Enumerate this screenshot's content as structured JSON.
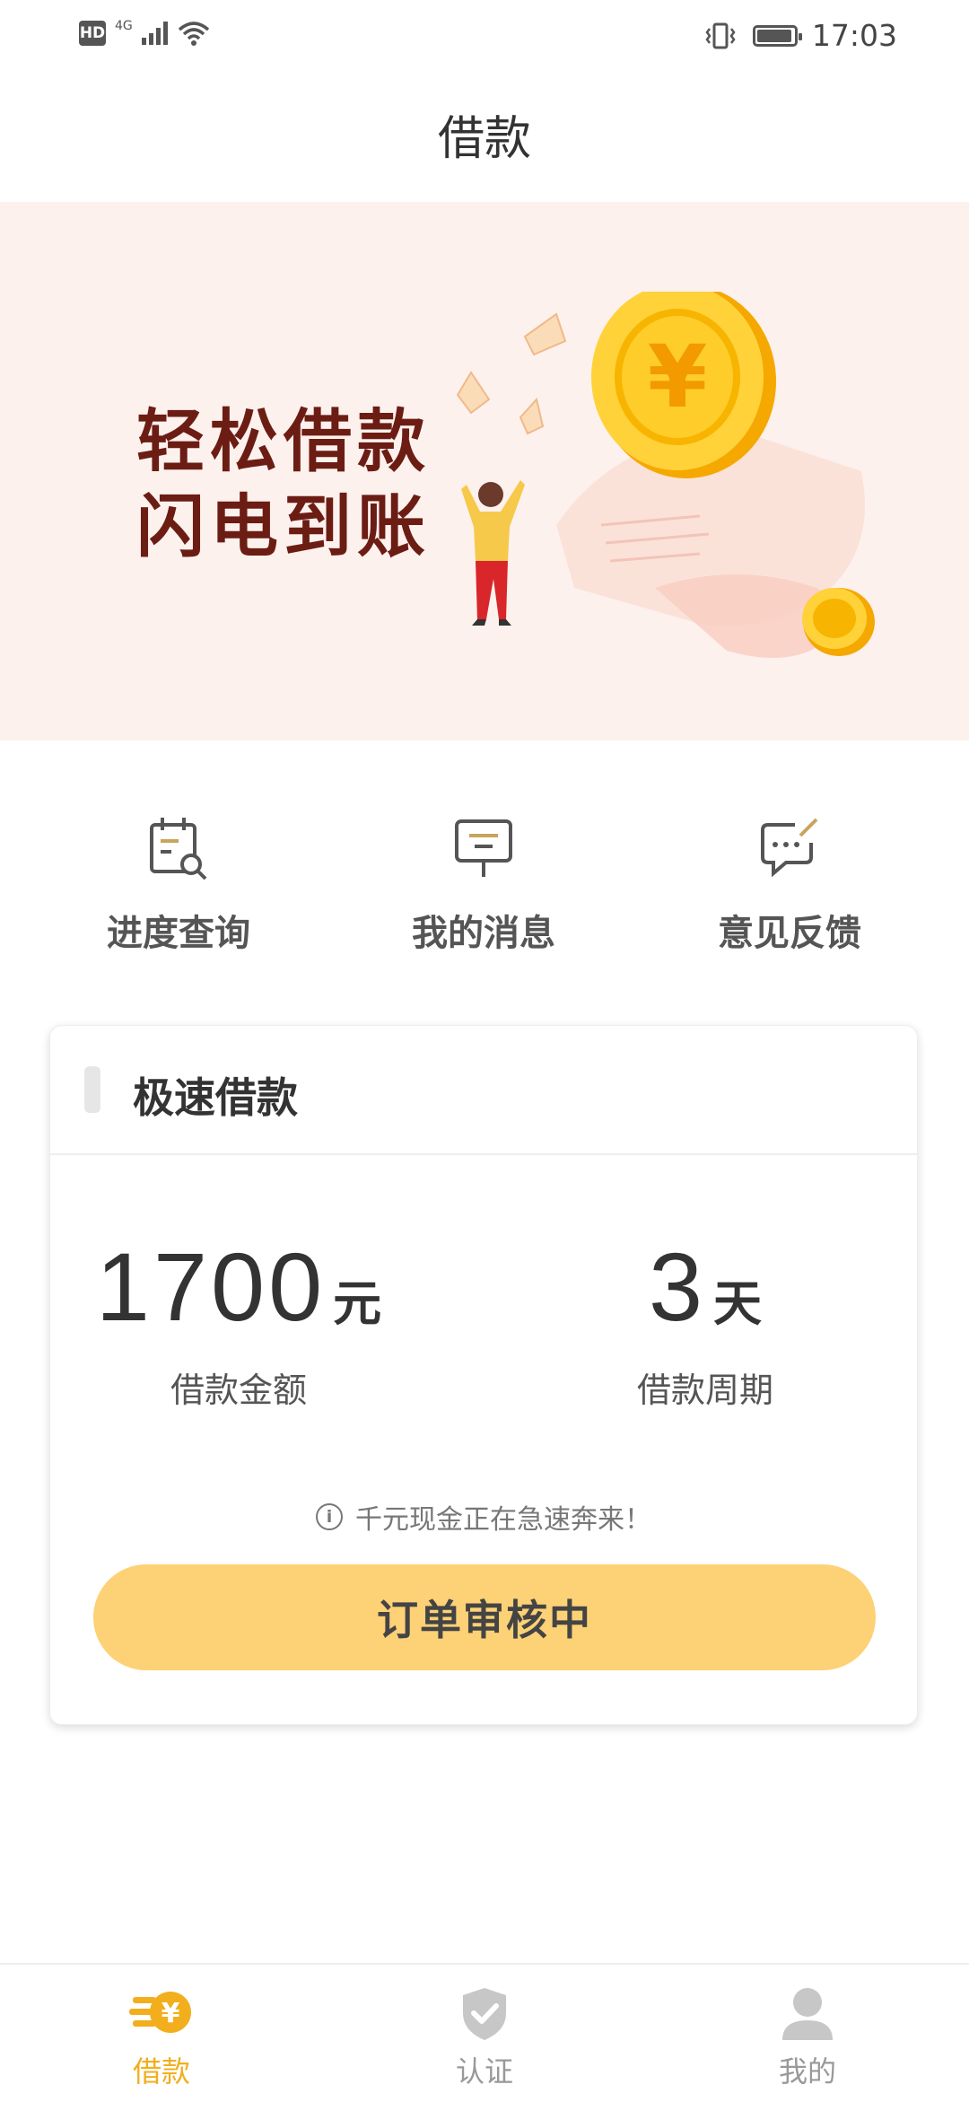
{
  "status_bar": {
    "hd": "HD",
    "network": "4G",
    "time": "17:03"
  },
  "page": {
    "title": "借款"
  },
  "banner": {
    "line1": "轻松借款",
    "line2": "闪电到账",
    "coin_symbol": "¥"
  },
  "quick_actions": [
    {
      "label": "进度查询",
      "icon": "calendar-search-icon"
    },
    {
      "label": "我的消息",
      "icon": "message-board-icon"
    },
    {
      "label": "意见反馈",
      "icon": "feedback-chat-icon"
    }
  ],
  "loan_card": {
    "title": "极速借款",
    "amount": {
      "value": "1700",
      "unit": "元",
      "label": "借款金额"
    },
    "period": {
      "value": "3",
      "unit": "天",
      "label": "借款周期"
    },
    "notice": "千元现金正在急速奔来！",
    "button_label": "订单审核中"
  },
  "bottom_nav": [
    {
      "label": "借款",
      "icon": "loan-coin-icon",
      "active": true
    },
    {
      "label": "认证",
      "icon": "shield-check-icon",
      "active": false
    },
    {
      "label": "我的",
      "icon": "user-icon",
      "active": false
    }
  ],
  "colors": {
    "accent": "#f2ae1d",
    "button": "#fdd175",
    "banner_bg": "#fdf1ee",
    "banner_text": "#6b1d14"
  }
}
